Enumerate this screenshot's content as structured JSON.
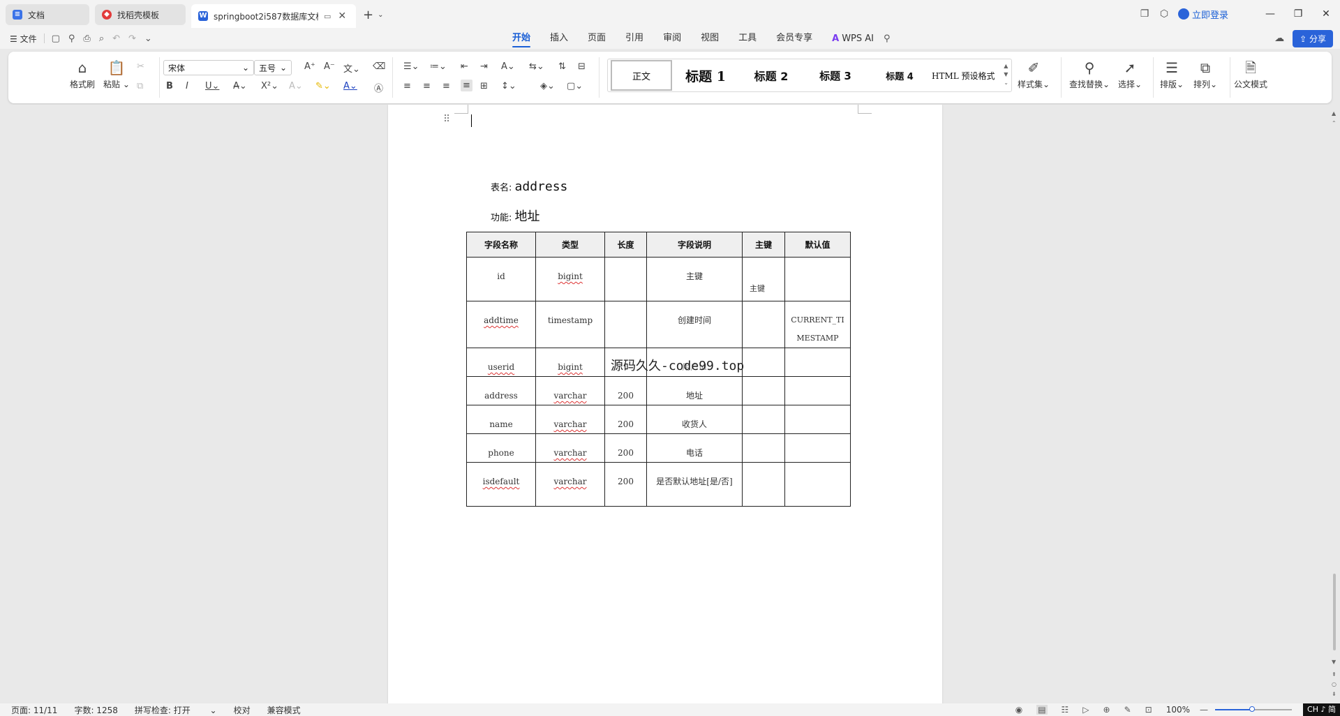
{
  "tabs": [
    {
      "label": "文档",
      "icon": "docs-icon",
      "active": false
    },
    {
      "label": "找稻壳模板",
      "icon": "docer-icon",
      "active": false
    },
    {
      "label": "springboot2i587数据库文档",
      "icon": "word-icon",
      "active": true
    }
  ],
  "header": {
    "login_label": "立即登录",
    "share_label": "分享"
  },
  "menu": {
    "file_label": "文件",
    "tabs": [
      "开始",
      "插入",
      "页面",
      "引用",
      "审阅",
      "视图",
      "工具",
      "会员专享"
    ],
    "active_tab": "开始",
    "wps_ai_label": "WPS AI"
  },
  "ribbon": {
    "format_painter": "格式刷",
    "paste": "粘贴",
    "font_name": "宋体",
    "font_size": "五号",
    "styles": [
      "正文",
      "标题 1",
      "标题 2",
      "标题 3",
      "标题 4",
      "HTML 预设格式"
    ],
    "style_set": "样式集",
    "find_replace": "查找替换",
    "select": "选择",
    "typeset": "排版",
    "arrange": "排列",
    "official_mode": "公文模式"
  },
  "document": {
    "table_name_label": "表名:",
    "table_name": "address",
    "function_label": "功能:",
    "function": "地址",
    "watermark": "源码久久-code99.top",
    "table": {
      "headers": [
        "字段名称",
        "类型",
        "长度",
        "字段说明",
        "主键",
        "默认值"
      ],
      "rows": [
        {
          "name": "id",
          "type": "bigint",
          "length": "",
          "desc": "主键",
          "pk": "主键",
          "default": ""
        },
        {
          "name": "addtime",
          "type": "timestamp",
          "length": "",
          "desc": "创建时间",
          "pk": "",
          "default": "CURRENT_TIMESTAMP"
        },
        {
          "name": "userid",
          "type": "bigint",
          "length": "",
          "desc": "用户id",
          "pk": "",
          "default": ""
        },
        {
          "name": "address",
          "type": "varchar",
          "length": "200",
          "desc": "地址",
          "pk": "",
          "default": ""
        },
        {
          "name": "name",
          "type": "varchar",
          "length": "200",
          "desc": "收货人",
          "pk": "",
          "default": ""
        },
        {
          "name": "phone",
          "type": "varchar",
          "length": "200",
          "desc": "电话",
          "pk": "",
          "default": ""
        },
        {
          "name": "isdefault",
          "type": "varchar",
          "length": "200",
          "desc": "是否默认地址[是/否]",
          "pk": "",
          "default": ""
        }
      ]
    }
  },
  "status": {
    "page": "页面: 11/11",
    "word_count": "字数: 1258",
    "spell_check": "拼写检查: 打开",
    "proofread": "校对",
    "compat_mode": "兼容模式",
    "zoom": "100%",
    "zoom_fraction": 0.48,
    "ime": "CH ♪ 简"
  },
  "colors": {
    "accent": "#2a63d9",
    "tab_active_text": "#1a5fd6"
  }
}
